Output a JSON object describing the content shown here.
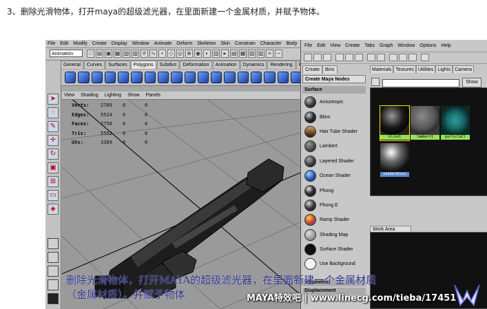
{
  "caption": "3、删除光滑物体，打开maya的超级滤光器，在里面新建一个金属材质，并赋予物体。",
  "maya": {
    "menu": [
      "File",
      "Edit",
      "Modify",
      "Create",
      "Display",
      "Window",
      "Animate",
      "Deform",
      "Skeleton",
      "Skin",
      "Constrain",
      "Character",
      "Body"
    ],
    "mode": "Animation",
    "shelf_tabs": [
      "General",
      "Curves",
      "Surfaces",
      "Polygons",
      "Subdivs",
      "Deformation",
      "Animation",
      "Dynamics",
      "Rendering",
      "PaintE"
    ],
    "active_shelf_tab": "Polygons",
    "viewport_menu": [
      "View",
      "Shading",
      "Lighting",
      "Show",
      "Panels"
    ],
    "hud": [
      {
        "key": "Verts:",
        "v1": "2789",
        "v2": "0",
        "v3": "0"
      },
      {
        "key": "Edges:",
        "v1": "5524",
        "v2": "0",
        "v3": "0"
      },
      {
        "key": "Faces:",
        "v1": "2758",
        "v2": "0",
        "v3": "0"
      },
      {
        "key": "Tris:",
        "v1": "5552",
        "v2": "0",
        "v3": "0"
      },
      {
        "key": "UVs:",
        "v1": "3389",
        "v2": "0",
        "v3": "0"
      }
    ]
  },
  "hypershade": {
    "menu": [
      "File",
      "Edit",
      "View",
      "Create",
      "Tabs",
      "Graph",
      "Window",
      "Options",
      "Help"
    ],
    "create_tabs": [
      "Create",
      "Bins"
    ],
    "create_nodes_label": "Create Maya Nodes",
    "surface_label": "Surface",
    "nodes": [
      {
        "name": "Anisotropic",
        "color": "#3a3a3a"
      },
      {
        "name": "Blinn",
        "color": "#2a2a2a"
      },
      {
        "name": "Hair Tube Shader",
        "color": "#6a4a2a"
      },
      {
        "name": "Lambert",
        "color": "#4a4a4a"
      },
      {
        "name": "Layered Shader",
        "color": "#3e3e3e"
      },
      {
        "name": "Ocean Shader",
        "color": "#2a5ab0"
      },
      {
        "name": "Phong",
        "color": "#333333"
      },
      {
        "name": "Phong E",
        "color": "#3a3a3a"
      },
      {
        "name": "Ramp Shader",
        "color": "#c0402a"
      },
      {
        "name": "Shading Map",
        "color": "#9a9a9a"
      },
      {
        "name": "Surface Shader",
        "color": "#101010"
      },
      {
        "name": "Use Background",
        "color": "#f4f4f4"
      }
    ],
    "volumetric_label": "Volumetric",
    "displacement_label": "Displacement",
    "tabs": [
      "Materials",
      "Textures",
      "Utilities",
      "Lights",
      "Camera"
    ],
    "show_label": "Show",
    "materials": [
      {
        "name": "blinn1",
        "color": "#1a1a1a"
      },
      {
        "name": "lambert1",
        "color": "#555555"
      },
      {
        "name": "particleCl",
        "color": "#1a6a6a"
      },
      {
        "name": "shader01sss",
        "color": "#6a6a6a"
      }
    ],
    "work_area_label": "Work Area"
  },
  "overlay": {
    "line1": "删除光滑物体，打开MAYA的超级滤光器，在里面新建一个金属材质",
    "line2": "（金属材质）。并赋予物体"
  },
  "watermark": "MAYA特效吧 | www.linecg.com/tieba/17451"
}
